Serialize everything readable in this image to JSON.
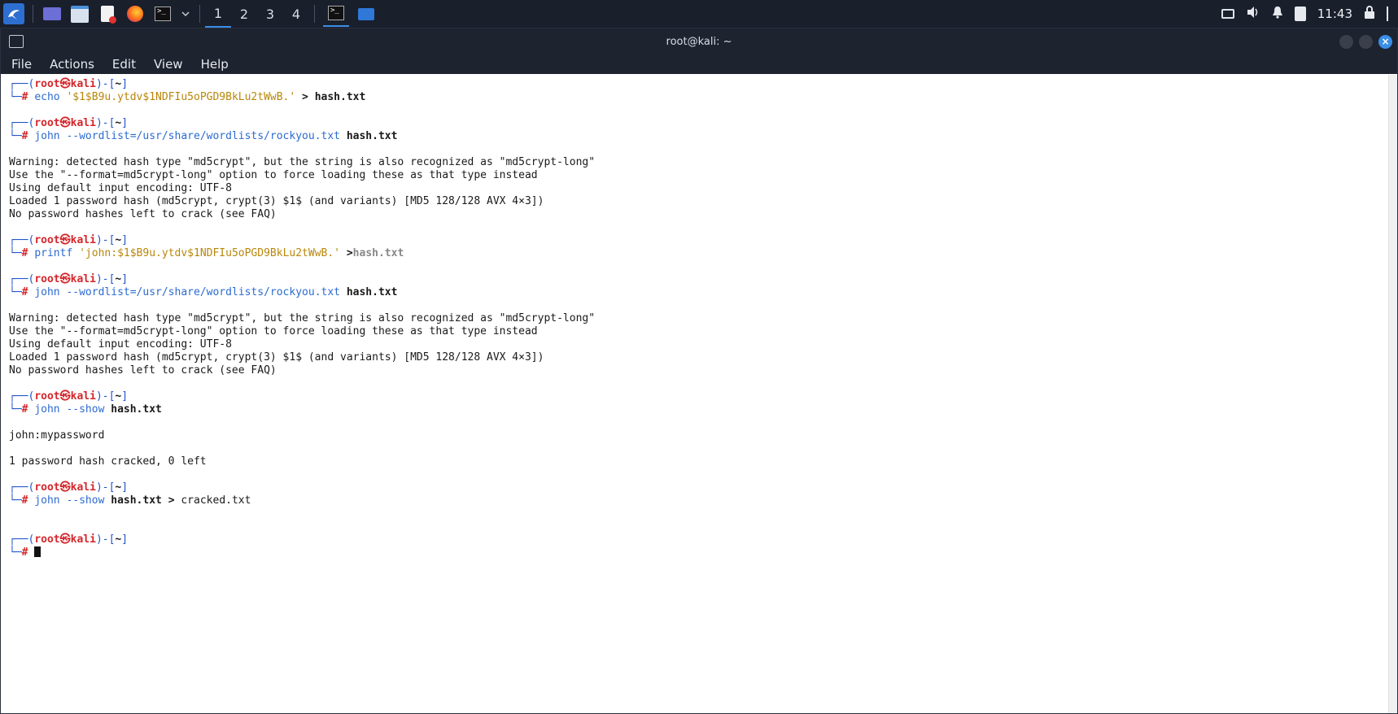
{
  "taskbar": {
    "workspaces": [
      "1",
      "2",
      "3",
      "4"
    ],
    "active_workspace": "1",
    "clock": "11:43"
  },
  "window": {
    "title": "root@kali: ~",
    "menu": [
      "File",
      "Actions",
      "Edit",
      "View",
      "Help"
    ]
  },
  "terminal": {
    "prompt_user": "root",
    "prompt_skull": "㉿",
    "prompt_host": "kali",
    "prompt_dir": "~",
    "blocks": [
      {
        "cmd": "echo",
        "arg1": "'$1$B9u.ytdv$1NDFIu5oPGD9BkLu2tWwB.'",
        "redir": ">",
        "file": "hash.txt"
      },
      {
        "cmd": "john",
        "args": "--wordlist=/usr/share/wordlists/rockyou.txt",
        "file": "hash.txt",
        "output": [
          "Warning: detected hash type \"md5crypt\", but the string is also recognized as \"md5crypt-long\"",
          "Use the \"--format=md5crypt-long\" option to force loading these as that type instead",
          "Using default input encoding: UTF-8",
          "Loaded 1 password hash (md5crypt, crypt(3) $1$ (and variants) [MD5 128/128 AVX 4×3])",
          "No password hashes left to crack (see FAQ)"
        ]
      },
      {
        "cmd": "printf",
        "arg1": "'john:$1$B9u.ytdv$1NDFIu5oPGD9BkLu2tWwB.'",
        "redir": ">",
        "file": "hash.txt"
      },
      {
        "cmd": "john",
        "args": "--wordlist=/usr/share/wordlists/rockyou.txt",
        "file": "hash.txt",
        "output": [
          "Warning: detected hash type \"md5crypt\", but the string is also recognized as \"md5crypt-long\"",
          "Use the \"--format=md5crypt-long\" option to force loading these as that type instead",
          "Using default input encoding: UTF-8",
          "Loaded 1 password hash (md5crypt, crypt(3) $1$ (and variants) [MD5 128/128 AVX 4×3])",
          "No password hashes left to crack (see FAQ)"
        ]
      },
      {
        "cmd": "john",
        "args": "--show",
        "file": "hash.txt",
        "output": [
          "john:mypassword",
          "",
          "1 password hash cracked, 0 left"
        ]
      },
      {
        "cmd": "john",
        "args": "--show",
        "file": "hash.txt",
        "redir": ">",
        "out": "cracked.txt"
      }
    ]
  }
}
